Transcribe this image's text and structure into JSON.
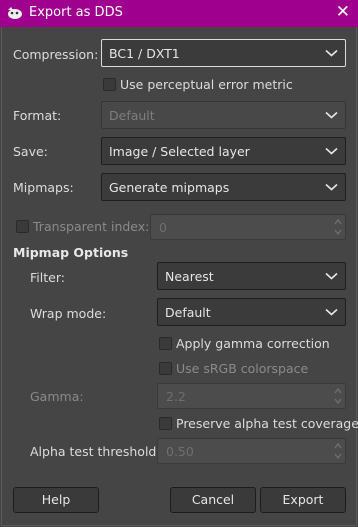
{
  "window": {
    "title": "Export as DDS"
  },
  "compression": {
    "label": "Compression:",
    "value": "BC1 / DXT1"
  },
  "perceptual": {
    "label": "Use perceptual error metric"
  },
  "format": {
    "label": "Format:",
    "value": "Default"
  },
  "save": {
    "label": "Save:",
    "value": "Image / Selected layer"
  },
  "mipmaps": {
    "label": "Mipmaps:",
    "value": "Generate mipmaps"
  },
  "transparent_index": {
    "label": "Transparent index:",
    "value": "0"
  },
  "mipmap_options": {
    "title": "Mipmap Options",
    "filter": {
      "label": "Filter:",
      "value": "Nearest"
    },
    "wrap_mode": {
      "label": "Wrap mode:",
      "value": "Default"
    },
    "apply_gamma": {
      "label": "Apply gamma correction"
    },
    "use_srgb": {
      "label": "Use sRGB colorspace"
    },
    "gamma": {
      "label": "Gamma:",
      "value": "2.2"
    },
    "preserve_alpha": {
      "label": "Preserve alpha test coverage"
    },
    "alpha_threshold": {
      "label": "Alpha test threshold:",
      "value": "0.50"
    }
  },
  "buttons": {
    "help": "Help",
    "cancel": "Cancel",
    "export": "Export"
  },
  "colors": {
    "titlebar": "#a0008e",
    "background": "#454545"
  }
}
